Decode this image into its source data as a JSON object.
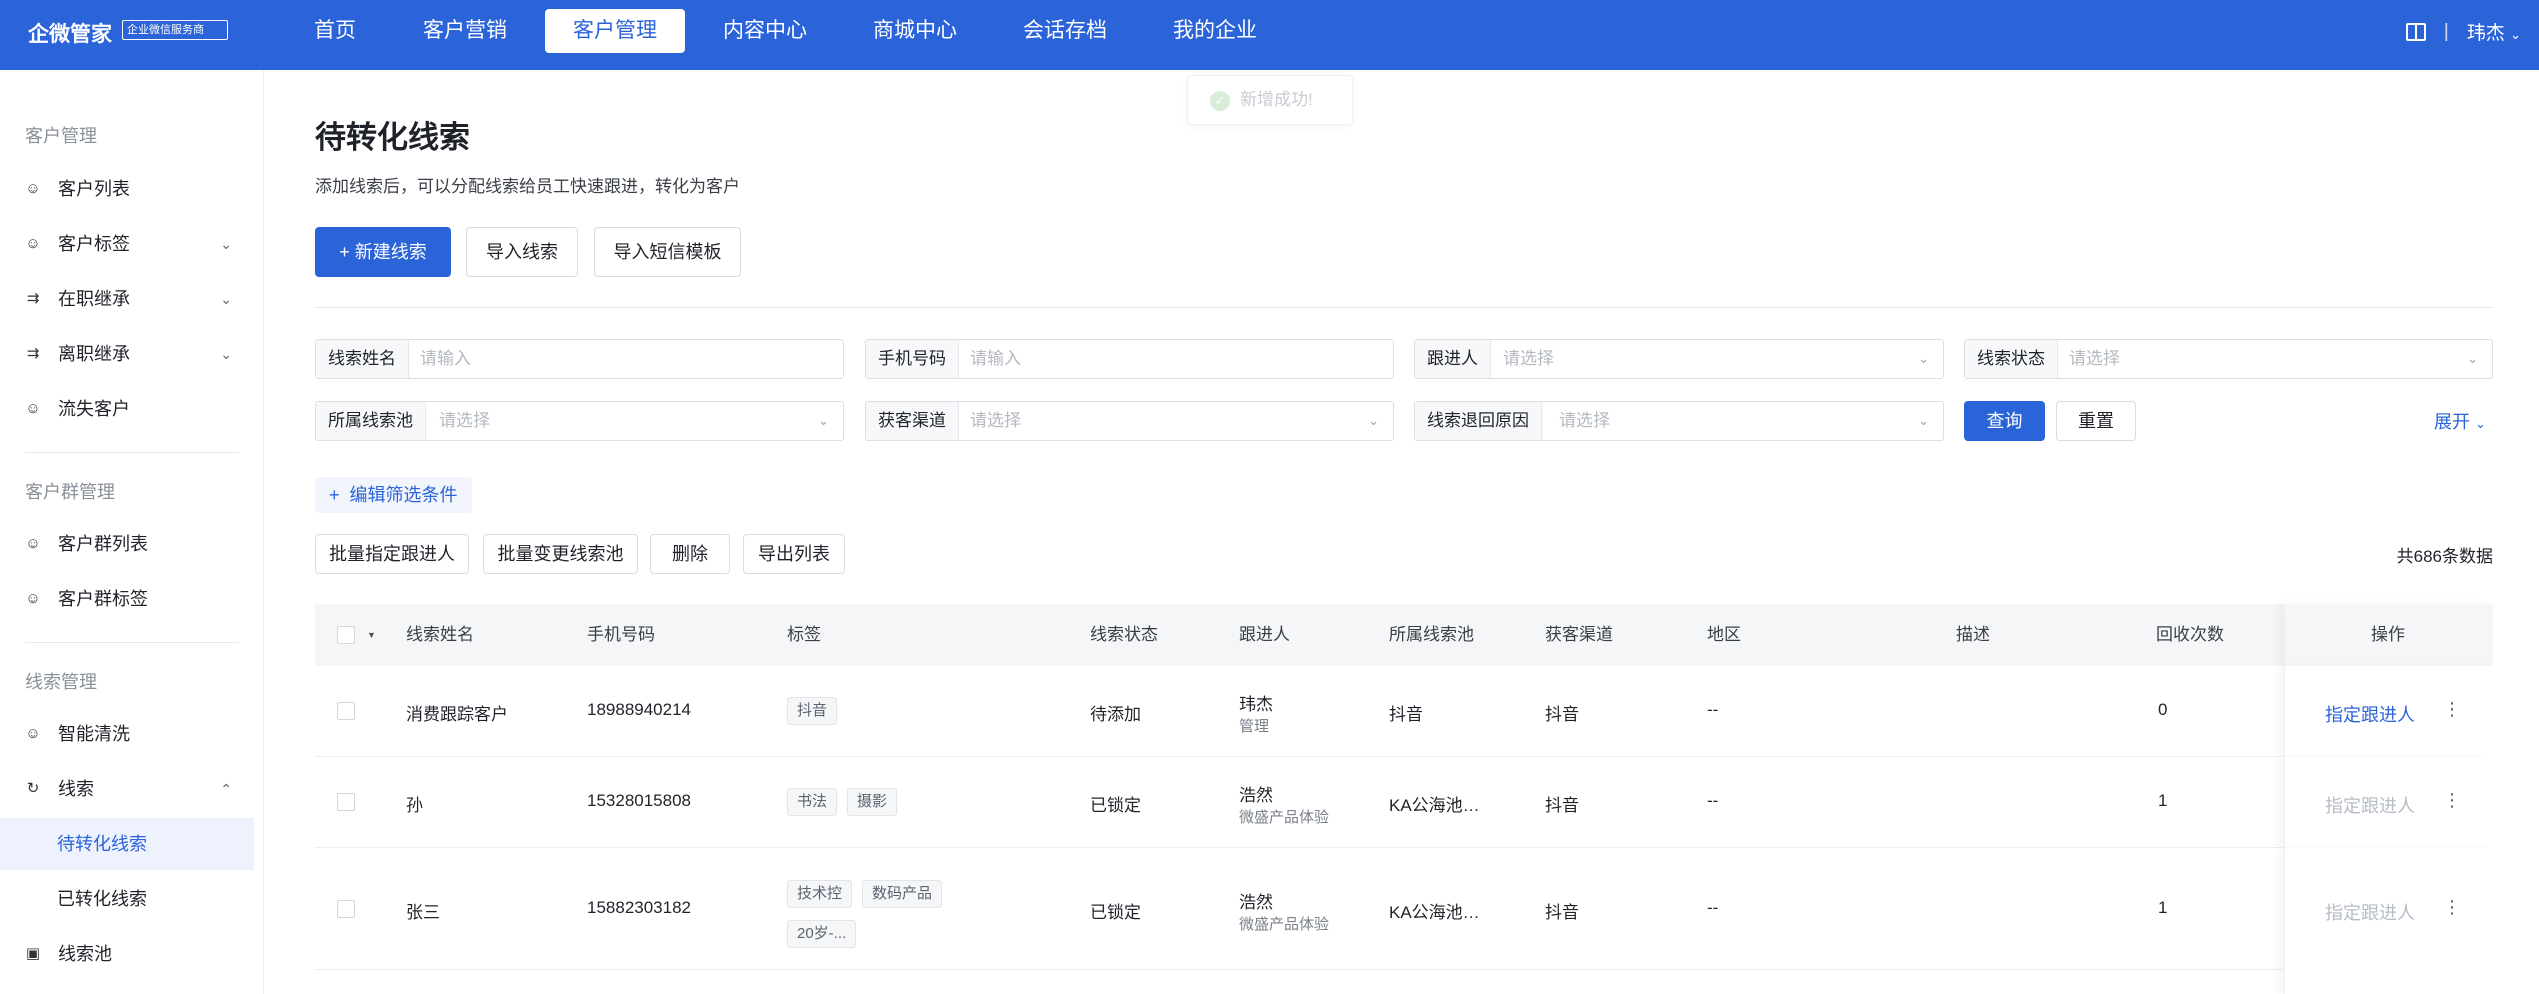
{
  "topbar": {
    "brand": "企微管家",
    "badge": "企业微信服务商",
    "nav": [
      "首页",
      "客户营销",
      "客户管理",
      "内容中心",
      "商城中心",
      "会话存档",
      "我的企业"
    ],
    "active_nav": "客户管理",
    "divider": "|",
    "user": "玮杰"
  },
  "sidebar": {
    "groups": [
      "客户管理",
      "客户群管理",
      "线索管理"
    ],
    "items": [
      {
        "label": "客户列表",
        "icon": "user-icon"
      },
      {
        "label": "客户标签",
        "icon": "user-tag-icon"
      },
      {
        "label": "在职继承",
        "icon": "transfer-icon"
      },
      {
        "label": "离职继承",
        "icon": "transfer-out-icon"
      },
      {
        "label": "流失客户",
        "icon": "user-lost-icon"
      },
      {
        "label": "客户群列表",
        "icon": "group-icon"
      },
      {
        "label": "客户群标签",
        "icon": "group-tag-icon"
      },
      {
        "label": "智能清洗",
        "icon": "clean-icon"
      },
      {
        "label": "线索",
        "icon": "clue-icon"
      },
      {
        "label": "待转化线索",
        "icon": ""
      },
      {
        "label": "已转化线索",
        "icon": ""
      },
      {
        "label": "线索池",
        "icon": "pool-icon"
      }
    ]
  },
  "toast": {
    "text": "新增成功!"
  },
  "page": {
    "title": "待转化线索",
    "desc": "添加线索后，可以分配线索给员工快速跟进，转化为客户"
  },
  "actions": {
    "new_clue": "+ 新建线索",
    "import_clue": "导入线索",
    "import_sms": "导入短信模板"
  },
  "filters": {
    "name": {
      "label": "线索姓名",
      "placeholder": "请输入"
    },
    "phone": {
      "label": "手机号码",
      "placeholder": "请输入"
    },
    "follower": {
      "label": "跟进人",
      "placeholder": "请选择"
    },
    "status": {
      "label": "线索状态",
      "placeholder": "请选择"
    },
    "pool": {
      "label": "所属线索池",
      "placeholder": "请选择"
    },
    "channel": {
      "label": "获客渠道",
      "placeholder": "请选择"
    },
    "reason": {
      "label": "线索退回原因",
      "placeholder": "请选择"
    },
    "query": "查询",
    "reset": "重置",
    "expand": "展开",
    "edit": "编辑筛选条件"
  },
  "bulk": {
    "assign": "批量指定跟进人",
    "change_pool": "批量变更线索池",
    "delete": "删除",
    "export": "导出列表",
    "total": "共686条数据"
  },
  "table": {
    "columns": [
      "线索姓名",
      "手机号码",
      "标签",
      "线索状态",
      "跟进人",
      "所属线索池",
      "获客渠道",
      "地区",
      "描述",
      "回收次数",
      "操作"
    ],
    "rows": [
      {
        "name": "消费跟踪客户",
        "phone": "18988940214",
        "tags": [
          "抖音"
        ],
        "status": "待添加",
        "follower": "玮杰",
        "follower_sub": "管理",
        "pool": "抖音",
        "channel": "抖音",
        "region": "--",
        "desc": "",
        "recycle": "0",
        "op": "指定跟进人",
        "op_enabled": true
      },
      {
        "name": "孙",
        "phone": "15328015808",
        "tags": [
          "书法",
          "摄影"
        ],
        "status": "已锁定",
        "follower": "浩然",
        "follower_sub": "微盛产品体验",
        "pool": "KA公海池…",
        "channel": "抖音",
        "region": "--",
        "desc": "",
        "recycle": "1",
        "op": "指定跟进人",
        "op_enabled": false
      },
      {
        "name": "张三",
        "phone": "15882303182",
        "tags": [
          "技术控",
          "数码产品",
          "20岁-..."
        ],
        "status": "已锁定",
        "follower": "浩然",
        "follower_sub": "微盛产品体验",
        "pool": "KA公海池…",
        "channel": "抖音",
        "region": "--",
        "desc": "",
        "recycle": "1",
        "op": "指定跟进人",
        "op_enabled": false
      }
    ]
  },
  "colors": {
    "primary": "#2b63d9",
    "topbar": "#2b63d9",
    "disabled_link": "#b6bcc6"
  }
}
